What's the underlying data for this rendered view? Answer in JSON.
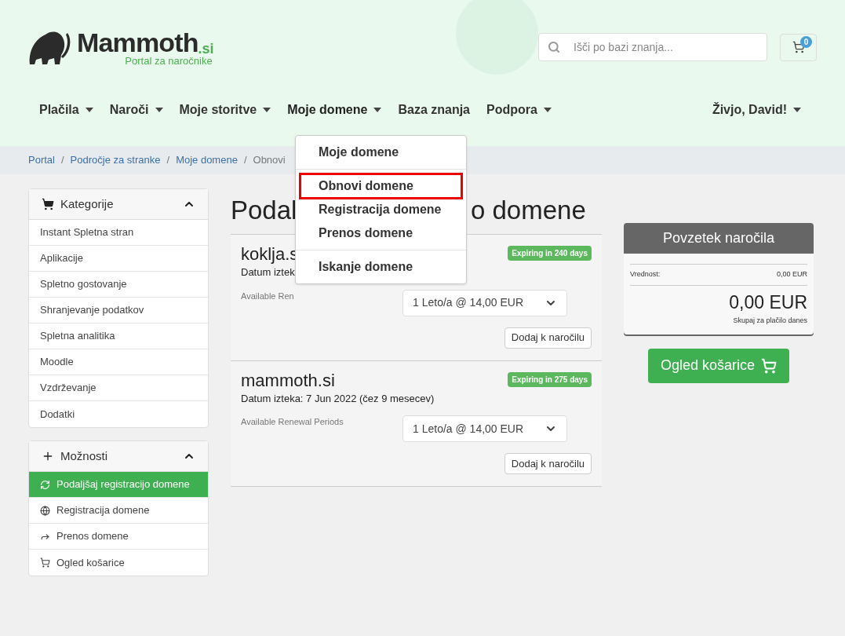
{
  "logo": {
    "name": "Mammoth",
    "suffix": ".si",
    "tagline": "Portal za naročnike"
  },
  "search": {
    "placeholder": "Išči po bazi znanja..."
  },
  "cart": {
    "count": "0"
  },
  "nav": [
    {
      "label": "Plačila",
      "dropdown": true,
      "open": false
    },
    {
      "label": "Naroči",
      "dropdown": true,
      "open": false
    },
    {
      "label": "Moje storitve",
      "dropdown": true,
      "open": false
    },
    {
      "label": "Moje domene",
      "dropdown": true,
      "open": true
    },
    {
      "label": "Baza znanja",
      "dropdown": false,
      "open": false
    },
    {
      "label": "Podpora",
      "dropdown": true,
      "open": false
    }
  ],
  "user_menu": "Živjo, David!",
  "dropdown_menu": [
    {
      "kind": "item",
      "label": "Moje domene",
      "selected": false
    },
    {
      "kind": "divider"
    },
    {
      "kind": "item",
      "label": "Obnovi domene",
      "selected": true
    },
    {
      "kind": "item",
      "label": "Registracija domene",
      "selected": false
    },
    {
      "kind": "item",
      "label": "Prenos domene",
      "selected": false
    },
    {
      "kind": "divider"
    },
    {
      "kind": "item",
      "label": "Iskanje domene",
      "selected": false
    }
  ],
  "breadcrumb": [
    "Portal",
    "Področje za stranke",
    "Moje domene",
    "Obnovi"
  ],
  "breadcrumb_separator": "/",
  "sidebar": [
    {
      "title": "Kategorije",
      "expanded": true,
      "items": [
        {
          "label": "Instant Spletna stran",
          "selected": false
        },
        {
          "label": "Aplikacije",
          "selected": false
        },
        {
          "label": "Spletno gostovanje",
          "selected": false
        },
        {
          "label": "Shranjevanje podatkov",
          "selected": false
        },
        {
          "label": "Spletna analitika",
          "selected": false
        },
        {
          "label": "Moodle",
          "selected": false
        },
        {
          "label": "Vzdrževanje",
          "selected": false
        },
        {
          "label": "Dodatki",
          "selected": false
        }
      ]
    },
    {
      "title": "Možnosti",
      "expanded": true,
      "items": [
        {
          "label": "Podaljšaj registracijo domene",
          "selected": true
        },
        {
          "label": "Registracija domene",
          "selected": false
        },
        {
          "label": "Prenos domene",
          "selected": false
        },
        {
          "label": "Ogled košarice",
          "selected": false
        }
      ]
    }
  ],
  "page_title": [
    "Podal",
    "o domene"
  ],
  "domains": [
    {
      "name": "koklja.s",
      "expiry": "Datum iztek",
      "badge": "Expiring in 240 days",
      "period_label": "Available Ren",
      "period": "1 Leto/a @ 14,00 EUR",
      "button": "Dodaj k naročilu"
    },
    {
      "name": "mammoth.si",
      "expiry": "Datum izteka: 7 Jun 2022 (čez 9 mesecev)",
      "badge": "Expiring in 275 days",
      "period_label": "Available Renewal Periods",
      "period": "1 Leto/a @ 14,00 EUR",
      "button": "Dodaj k naročilu"
    }
  ],
  "summary": {
    "title": "Povzetek naročila",
    "subtotal_label": "Vrednost:",
    "subtotal": "0,00 EUR",
    "total": "0,00 EUR",
    "total_label": "Skupaj za plačilo danes",
    "checkout": "Ogled košarice"
  }
}
